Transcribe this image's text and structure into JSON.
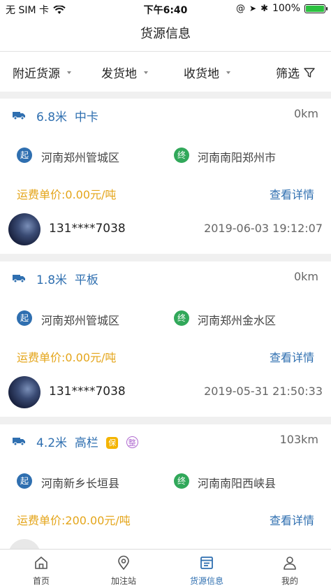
{
  "status_bar": {
    "carrier": "无 SIM 卡",
    "time": "下午6:40",
    "battery": "100%",
    "battery_level": 1.0
  },
  "nav": {
    "title": "货源信息"
  },
  "filters": [
    {
      "label": "附近货源"
    },
    {
      "label": "发货地"
    },
    {
      "label": "收货地"
    },
    {
      "label": "筛选"
    }
  ],
  "cards": [
    {
      "length": "6.8米",
      "type": "中卡",
      "distance": "0km",
      "start_badge": "起",
      "from": "河南郑州管城区",
      "end_badge": "终",
      "to": "河南南阳郑州市",
      "price": "运费单价:0.00元/吨",
      "detail": "查看详情",
      "phone": "131****7038",
      "time": "2019-06-03 19:12:07"
    },
    {
      "length": "1.8米",
      "type": "平板",
      "distance": "0km",
      "start_badge": "起",
      "from": "河南郑州管城区",
      "end_badge": "终",
      "to": "河南郑州金水区",
      "price": "运费单价:0.00元/吨",
      "detail": "查看详情",
      "phone": "131****7038",
      "time": "2019-05-31 21:50:33"
    },
    {
      "length": "4.2米",
      "type": "高栏",
      "badge_bao": "保",
      "badge_zheng": "整",
      "distance": "103km",
      "start_badge": "起",
      "from": "河南新乡长垣县",
      "end_badge": "终",
      "to": "河南南阳西峡县",
      "price": "运费单价:200.00元/吨",
      "detail": "查看详情"
    }
  ],
  "tabs": [
    {
      "label": "首页",
      "icon": "home-icon"
    },
    {
      "label": "加注站",
      "icon": "location-pin-icon"
    },
    {
      "label": "货源信息",
      "icon": "cargo-list-icon",
      "active": true
    },
    {
      "label": "我的",
      "icon": "user-icon"
    }
  ],
  "colors": {
    "accent_blue": "#2f6fb0",
    "price_orange": "#e4a51a",
    "end_green": "#31a85a"
  }
}
